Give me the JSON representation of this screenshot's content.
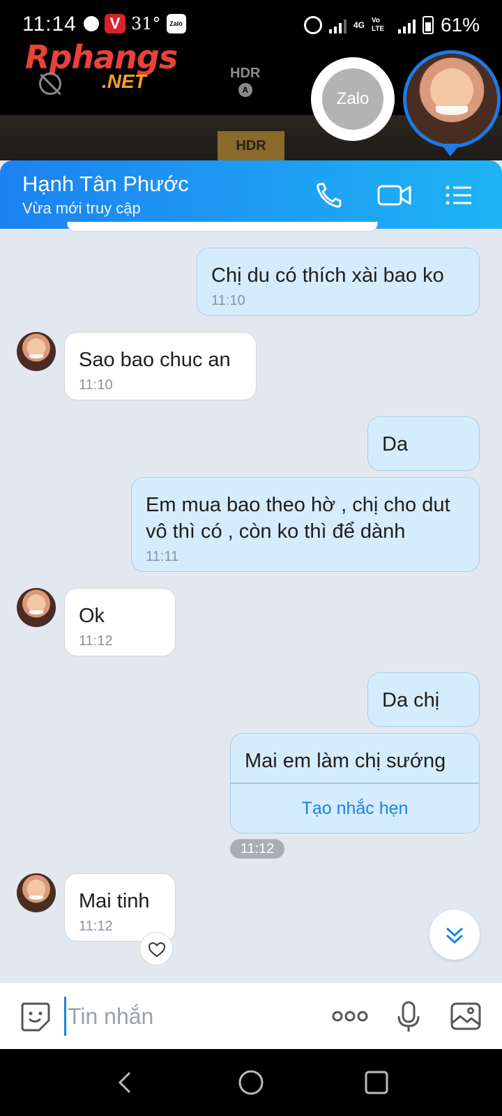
{
  "status_bar": {
    "time": "11:14",
    "temperature": "31°",
    "zalo_mini": "Zalo",
    "network": "4G",
    "volte": "Vo LTE",
    "battery": "61%"
  },
  "overlay": {
    "logo_main": "Rphangs",
    "logo_net": ".NET",
    "hdr_mode": "HDR",
    "hdr_auto": "A",
    "hdr_box": "HDR",
    "zalo_bubble": "Zalo"
  },
  "header": {
    "contact_name": "Hạnh Tân Phước",
    "status": "Vừa mới truy cập"
  },
  "messages": [
    {
      "direction": "out",
      "text": "Chị du có thích xài bao ko",
      "time": "11:10"
    },
    {
      "direction": "in",
      "text": "Sao bao chuc an",
      "time": "11:10"
    },
    {
      "direction": "out",
      "text": "Da",
      "time": ""
    },
    {
      "direction": "out",
      "text": "Em mua bao theo hờ , chị cho dut vô thì có , còn ko thì để dành",
      "time": "11:11"
    },
    {
      "direction": "in",
      "text": "Ok",
      "time": "11:12"
    },
    {
      "direction": "out",
      "text": "Da chị",
      "time": ""
    },
    {
      "direction": "out",
      "text": "Mai em làm chị sướng",
      "time": "",
      "action": "Tạo nhắc hẹn"
    },
    {
      "direction": "in",
      "text": "Mai tinh",
      "time": "11:12"
    }
  ],
  "time_divider": "11:12",
  "input": {
    "placeholder": "Tin nhắn",
    "value": ""
  },
  "colors": {
    "header_start": "#1c82f0",
    "header_end": "#1fb4f5",
    "bubble_out": "#d5ecfc",
    "bubble_in": "#ffffff",
    "background": "#e2e8f0",
    "accent": "#1a84e0"
  },
  "icons": [
    "phone-icon",
    "video-call-icon",
    "menu-list-icon",
    "emoji-sticker-icon",
    "more-options-icon",
    "microphone-icon",
    "image-gallery-icon",
    "heart-icon",
    "chevron-double-down-icon",
    "back-nav-icon",
    "home-nav-icon",
    "recents-nav-icon"
  ]
}
